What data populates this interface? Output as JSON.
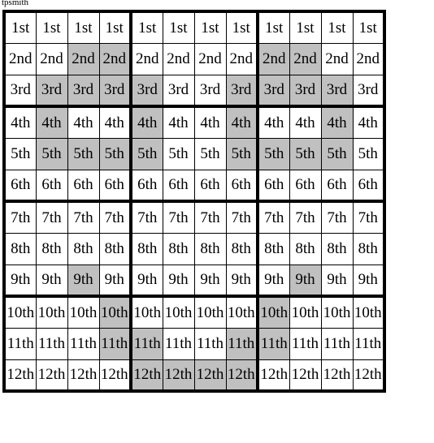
{
  "caption": "tpsmith",
  "grid": {
    "rows": 12,
    "columns": 12,
    "column_group_size": 4,
    "row_group_size": 3,
    "shaded_color": "#c0c0c0",
    "empty_color": "#ffffff",
    "border_color": "#000000",
    "row_labels": [
      "1st",
      "2nd",
      "3rd",
      "4th",
      "5th",
      "6th",
      "7th",
      "8th",
      "9th",
      "10th",
      "11th",
      "12th"
    ],
    "cells": [
      [
        {
          "label": "1st",
          "shaded": false
        },
        {
          "label": "1st",
          "shaded": false
        },
        {
          "label": "1st",
          "shaded": false
        },
        {
          "label": "1st",
          "shaded": false
        },
        {
          "label": "1st",
          "shaded": false
        },
        {
          "label": "1st",
          "shaded": false
        },
        {
          "label": "1st",
          "shaded": false
        },
        {
          "label": "1st",
          "shaded": false
        },
        {
          "label": "1st",
          "shaded": false
        },
        {
          "label": "1st",
          "shaded": false
        },
        {
          "label": "1st",
          "shaded": false
        },
        {
          "label": "1st",
          "shaded": false
        }
      ],
      [
        {
          "label": "2nd",
          "shaded": false
        },
        {
          "label": "2nd",
          "shaded": false
        },
        {
          "label": "2nd",
          "shaded": true
        },
        {
          "label": "2nd",
          "shaded": true
        },
        {
          "label": "2nd",
          "shaded": false
        },
        {
          "label": "2nd",
          "shaded": false
        },
        {
          "label": "2nd",
          "shaded": false
        },
        {
          "label": "2nd",
          "shaded": false
        },
        {
          "label": "2nd",
          "shaded": true
        },
        {
          "label": "2nd",
          "shaded": true
        },
        {
          "label": "2nd",
          "shaded": false
        },
        {
          "label": "2nd",
          "shaded": false
        }
      ],
      [
        {
          "label": "3rd",
          "shaded": false
        },
        {
          "label": "3rd",
          "shaded": true
        },
        {
          "label": "3rd",
          "shaded": true
        },
        {
          "label": "3rd",
          "shaded": true
        },
        {
          "label": "3rd",
          "shaded": true
        },
        {
          "label": "3rd",
          "shaded": false
        },
        {
          "label": "3rd",
          "shaded": false
        },
        {
          "label": "3rd",
          "shaded": true
        },
        {
          "label": "3rd",
          "shaded": true
        },
        {
          "label": "3rd",
          "shaded": true
        },
        {
          "label": "3rd",
          "shaded": true
        },
        {
          "label": "3rd",
          "shaded": false
        }
      ],
      [
        {
          "label": "4th",
          "shaded": false
        },
        {
          "label": "4th",
          "shaded": true
        },
        {
          "label": "4th",
          "shaded": false
        },
        {
          "label": "4th",
          "shaded": false
        },
        {
          "label": "4th",
          "shaded": true
        },
        {
          "label": "4th",
          "shaded": false
        },
        {
          "label": "4th",
          "shaded": false
        },
        {
          "label": "4th",
          "shaded": true
        },
        {
          "label": "4th",
          "shaded": false
        },
        {
          "label": "4th",
          "shaded": false
        },
        {
          "label": "4th",
          "shaded": true
        },
        {
          "label": "4th",
          "shaded": false
        }
      ],
      [
        {
          "label": "5th",
          "shaded": false
        },
        {
          "label": "5th",
          "shaded": true
        },
        {
          "label": "5th",
          "shaded": true
        },
        {
          "label": "5th",
          "shaded": true
        },
        {
          "label": "5th",
          "shaded": true
        },
        {
          "label": "5th",
          "shaded": false
        },
        {
          "label": "5th",
          "shaded": false
        },
        {
          "label": "5th",
          "shaded": true
        },
        {
          "label": "5th",
          "shaded": true
        },
        {
          "label": "5th",
          "shaded": true
        },
        {
          "label": "5th",
          "shaded": true
        },
        {
          "label": "5th",
          "shaded": false
        }
      ],
      [
        {
          "label": "6th",
          "shaded": false
        },
        {
          "label": "6th",
          "shaded": false
        },
        {
          "label": "6th",
          "shaded": false
        },
        {
          "label": "6th",
          "shaded": false
        },
        {
          "label": "6th",
          "shaded": false
        },
        {
          "label": "6th",
          "shaded": false
        },
        {
          "label": "6th",
          "shaded": false
        },
        {
          "label": "6th",
          "shaded": false
        },
        {
          "label": "6th",
          "shaded": false
        },
        {
          "label": "6th",
          "shaded": false
        },
        {
          "label": "6th",
          "shaded": false
        },
        {
          "label": "6th",
          "shaded": false
        }
      ],
      [
        {
          "label": "7th",
          "shaded": false
        },
        {
          "label": "7th",
          "shaded": false
        },
        {
          "label": "7th",
          "shaded": false
        },
        {
          "label": "7th",
          "shaded": false
        },
        {
          "label": "7th",
          "shaded": false
        },
        {
          "label": "7th",
          "shaded": false
        },
        {
          "label": "7th",
          "shaded": false
        },
        {
          "label": "7th",
          "shaded": false
        },
        {
          "label": "7th",
          "shaded": false
        },
        {
          "label": "7th",
          "shaded": false
        },
        {
          "label": "7th",
          "shaded": false
        },
        {
          "label": "7th",
          "shaded": false
        }
      ],
      [
        {
          "label": "8th",
          "shaded": false
        },
        {
          "label": "8th",
          "shaded": false
        },
        {
          "label": "8th",
          "shaded": false
        },
        {
          "label": "8th",
          "shaded": false
        },
        {
          "label": "8th",
          "shaded": false
        },
        {
          "label": "8th",
          "shaded": false
        },
        {
          "label": "8th",
          "shaded": false
        },
        {
          "label": "8th",
          "shaded": false
        },
        {
          "label": "8th",
          "shaded": false
        },
        {
          "label": "8th",
          "shaded": false
        },
        {
          "label": "8th",
          "shaded": false
        },
        {
          "label": "8th",
          "shaded": false
        }
      ],
      [
        {
          "label": "9th",
          "shaded": false
        },
        {
          "label": "9th",
          "shaded": false
        },
        {
          "label": "9th",
          "shaded": true
        },
        {
          "label": "9th",
          "shaded": false
        },
        {
          "label": "9th",
          "shaded": false
        },
        {
          "label": "9th",
          "shaded": false
        },
        {
          "label": "9th",
          "shaded": false
        },
        {
          "label": "9th",
          "shaded": false
        },
        {
          "label": "9th",
          "shaded": false
        },
        {
          "label": "9th",
          "shaded": true
        },
        {
          "label": "9th",
          "shaded": false
        },
        {
          "label": "9th",
          "shaded": false
        }
      ],
      [
        {
          "label": "10th",
          "shaded": false
        },
        {
          "label": "10th",
          "shaded": false
        },
        {
          "label": "10th",
          "shaded": false
        },
        {
          "label": "10th",
          "shaded": true
        },
        {
          "label": "10th",
          "shaded": false
        },
        {
          "label": "10th",
          "shaded": false
        },
        {
          "label": "10th",
          "shaded": false
        },
        {
          "label": "10th",
          "shaded": false
        },
        {
          "label": "10th",
          "shaded": true
        },
        {
          "label": "10th",
          "shaded": false
        },
        {
          "label": "10th",
          "shaded": false
        },
        {
          "label": "10th",
          "shaded": false
        }
      ],
      [
        {
          "label": "11th",
          "shaded": false
        },
        {
          "label": "11th",
          "shaded": false
        },
        {
          "label": "11th",
          "shaded": false
        },
        {
          "label": "11th",
          "shaded": true
        },
        {
          "label": "11th",
          "shaded": true
        },
        {
          "label": "11th",
          "shaded": false
        },
        {
          "label": "11th",
          "shaded": false
        },
        {
          "label": "11th",
          "shaded": true
        },
        {
          "label": "11th",
          "shaded": true
        },
        {
          "label": "11th",
          "shaded": false
        },
        {
          "label": "11th",
          "shaded": false
        },
        {
          "label": "11th",
          "shaded": false
        }
      ],
      [
        {
          "label": "12th",
          "shaded": false
        },
        {
          "label": "12th",
          "shaded": false
        },
        {
          "label": "12th",
          "shaded": false
        },
        {
          "label": "12th",
          "shaded": false
        },
        {
          "label": "12th",
          "shaded": true
        },
        {
          "label": "12th",
          "shaded": true
        },
        {
          "label": "12th",
          "shaded": true
        },
        {
          "label": "12th",
          "shaded": true
        },
        {
          "label": "12th",
          "shaded": false
        },
        {
          "label": "12th",
          "shaded": false
        },
        {
          "label": "12th",
          "shaded": false
        },
        {
          "label": "12th",
          "shaded": false
        }
      ]
    ]
  }
}
